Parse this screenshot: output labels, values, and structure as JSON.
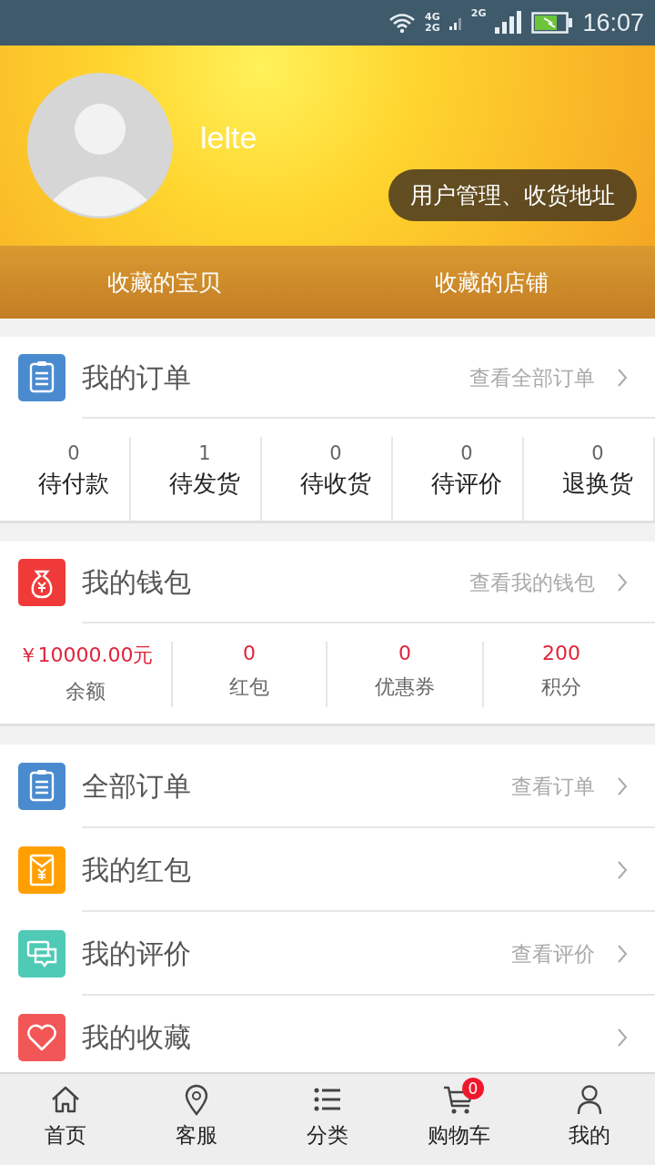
{
  "status_bar": {
    "network_labels": [
      "4G",
      "2G",
      "2G"
    ],
    "time": "16:07"
  },
  "profile": {
    "username": "lelte",
    "manage_button": "用户管理、收货地址"
  },
  "favorites": [
    "收藏的宝贝",
    "收藏的店铺"
  ],
  "orders": {
    "title": "我的订单",
    "link": "查看全部订单",
    "color": "#4a8bcf",
    "stats": [
      {
        "count": "0",
        "label": "待付款"
      },
      {
        "count": "1",
        "label": "待发货"
      },
      {
        "count": "0",
        "label": "待收货"
      },
      {
        "count": "0",
        "label": "待评价"
      },
      {
        "count": "0",
        "label": "退换货"
      }
    ]
  },
  "wallet": {
    "title": "我的钱包",
    "link": "查看我的钱包",
    "color": "#f03a3a",
    "stats": [
      {
        "value": "￥10000.00元",
        "label": "余额"
      },
      {
        "value": "0",
        "label": "红包"
      },
      {
        "value": "0",
        "label": "优惠券"
      },
      {
        "value": "200",
        "label": "积分"
      }
    ]
  },
  "menu": [
    {
      "kind": "orders",
      "title": "全部订单",
      "link": "查看订单",
      "color": "#4a8bcf"
    },
    {
      "kind": "redpacket",
      "title": "我的红包",
      "color": "#ffa000"
    },
    {
      "kind": "review",
      "title": "我的评价",
      "link": "查看评价",
      "color": "#4ecab6"
    },
    {
      "kind": "favorite",
      "title": "我的收藏",
      "color": "#f25656"
    }
  ],
  "tab_bar": [
    {
      "kind": "home",
      "label": "首页"
    },
    {
      "kind": "service",
      "label": "客服"
    },
    {
      "kind": "category",
      "label": "分类"
    },
    {
      "kind": "cart",
      "label": "购物车",
      "badge": "0"
    },
    {
      "kind": "me",
      "label": "我的"
    }
  ]
}
